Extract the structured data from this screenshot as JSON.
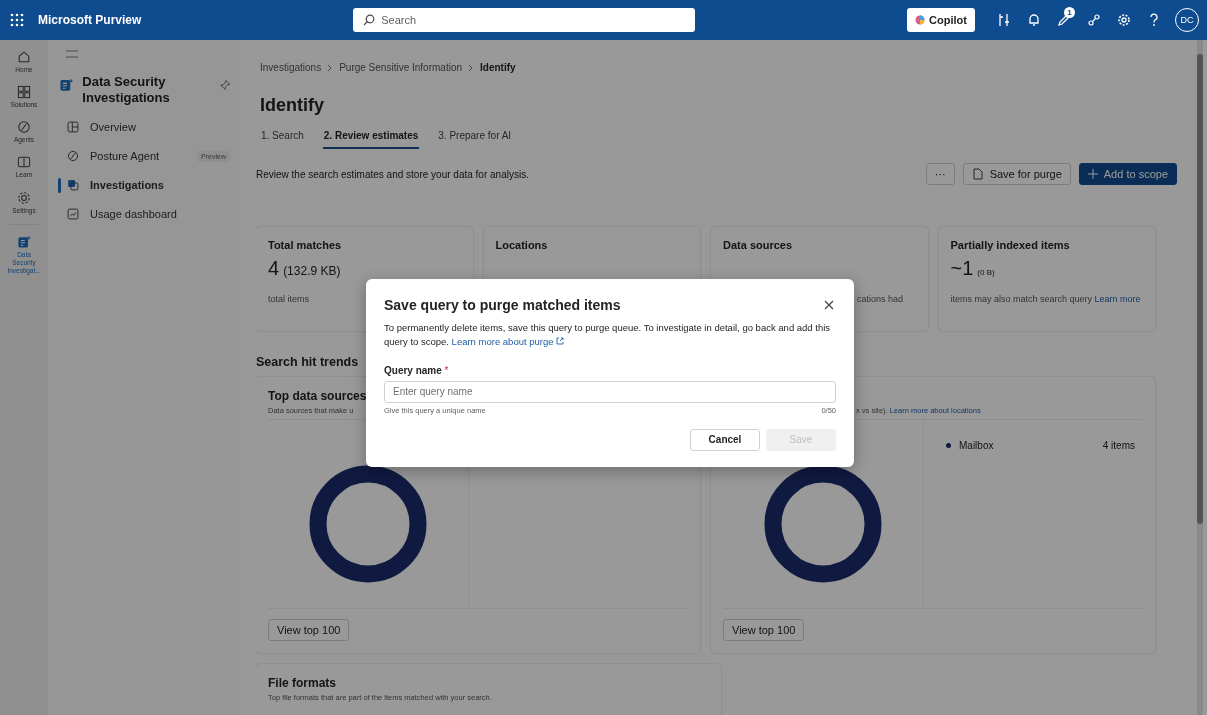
{
  "topbar": {
    "app_name": "Microsoft Purview",
    "search": {
      "placeholder": "Search"
    },
    "copilot": "Copilot",
    "notification_count": "1",
    "avatar": "DC"
  },
  "rail": [
    {
      "label": "Home",
      "selected": false
    },
    {
      "label": "Solutions",
      "selected": false
    },
    {
      "label": "Agents",
      "selected": false
    },
    {
      "label": "Learn",
      "selected": false
    },
    {
      "label": "Settings",
      "selected": false
    },
    {
      "label": "Data Security Investigat...",
      "selected": true
    }
  ],
  "nav": {
    "title": "Data Security Investigations",
    "items": [
      {
        "label": "Overview",
        "selected": false
      },
      {
        "label": "Posture Agent",
        "badge": "Preview",
        "selected": false
      },
      {
        "label": "Investigations",
        "selected": true
      },
      {
        "label": "Usage dashboard",
        "selected": false
      }
    ]
  },
  "breadcrumb": [
    "Investigations",
    "Purge Sensitive Information",
    "Identify"
  ],
  "page_title": "Identify",
  "tabs": [
    {
      "label": "1. Search",
      "selected": false
    },
    {
      "label": "2. Review estimates",
      "selected": true
    },
    {
      "label": "3. Prepare for AI",
      "selected": false
    }
  ],
  "description": "Review the search estimates and store your data for analysis.",
  "actions": {
    "more": "···",
    "save_for_purge": "Save for purge",
    "add_to_scope": "Add to scope"
  },
  "stats": [
    {
      "title": "Total matches",
      "value": "4",
      "unit": "(132.9 KB)",
      "note": "total items"
    },
    {
      "title": "Locations"
    },
    {
      "title": "Data sources",
      "note": "cations had"
    },
    {
      "title": "Partially indexed items",
      "value": "~1",
      "unit": "(0 B)",
      "note": "items may also match search query",
      "link": "Learn more"
    }
  ],
  "section_title": "Search hit trends",
  "charts": [
    {
      "title": "Top data sources",
      "subtitle": "Data sources that make u",
      "button": "View top 100"
    },
    {
      "subtitle": "x vs site).",
      "link": "Learn more about locations",
      "legend": [
        {
          "label": "Mailbox",
          "value": "4 items"
        }
      ],
      "button": "View top 100"
    }
  ],
  "file_formats": {
    "title": "File formats",
    "subtitle": "Top file formats that are part of the items matched with your search."
  },
  "dialog": {
    "title": "Save query to purge matched items",
    "body": "To permanently delete items, save this query to purge queue. To investigate in detail, go back and add this query to scope.",
    "link": "Learn more about purge",
    "field_label": "Query name",
    "required_mark": "*",
    "placeholder": "Enter query name",
    "hint": "Give this query a unique name",
    "counter": "0/50",
    "cancel": "Cancel",
    "save": "Save",
    "save_disabled": true
  }
}
